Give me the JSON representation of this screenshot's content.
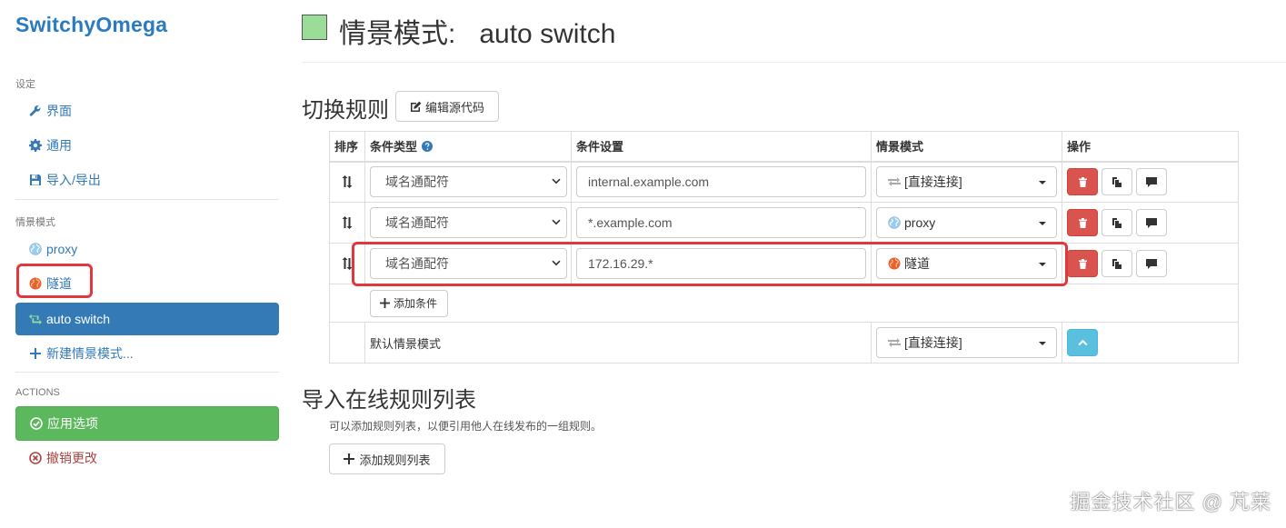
{
  "brand": "SwitchyOmega",
  "sidebar": {
    "settings_header": "设定",
    "settings_items": [
      {
        "label": "界面",
        "icon": "wrench-icon"
      },
      {
        "label": "通用",
        "icon": "gear-icon"
      },
      {
        "label": "导入/导出",
        "icon": "floppy-icon"
      }
    ],
    "profiles_header": "情景模式",
    "profiles": [
      {
        "label": "proxy",
        "icon": "globe-icon",
        "color": "#99ccee"
      },
      {
        "label": "隧道",
        "icon": "globe-icon",
        "color": "#e8622c"
      },
      {
        "label": "auto switch",
        "icon": "retweet-icon",
        "color": "#99dd99",
        "active": true
      }
    ],
    "new_profile": "新建情景模式...",
    "actions_header": "ACTIONS",
    "apply": "应用选项",
    "discard": "撤销更改"
  },
  "page": {
    "title_prefix": "情景模式:",
    "title_name": "auto switch",
    "color": "#99dd99"
  },
  "rules_section": {
    "heading": "切换规则",
    "edit_source": "编辑源代码",
    "columns": {
      "sort": "排序",
      "type": "条件类型",
      "setting": "条件设置",
      "profile": "情景模式",
      "ops": "操作"
    },
    "rows": [
      {
        "type": "域名通配符",
        "condition": "internal.example.com",
        "profile": "[直接连接]",
        "profile_icon": "transfer-icon"
      },
      {
        "type": "域名通配符",
        "condition": "*.example.com",
        "profile": "proxy",
        "profile_icon": "globe-icon",
        "profile_color": "#99ccee"
      },
      {
        "type": "域名通配符",
        "condition": "172.16.29.*",
        "profile": "隧道",
        "profile_icon": "globe-icon",
        "profile_color": "#e8622c"
      }
    ],
    "add_condition": "添加条件",
    "default_label": "默认情景模式",
    "default_profile": "[直接连接]"
  },
  "import_section": {
    "heading": "导入在线规则列表",
    "description": "可以添加规则列表，以便引用他人在线发布的一组规则。",
    "add_list": "添加规则列表"
  },
  "watermark": "掘金技术社区 @ 芃莱",
  "colors": {
    "link": "#337ab7",
    "active_bg": "#337ab7",
    "success": "#5cb85c",
    "danger": "#d9534f",
    "info": "#5bc0de",
    "highlight": "#e0383e"
  }
}
